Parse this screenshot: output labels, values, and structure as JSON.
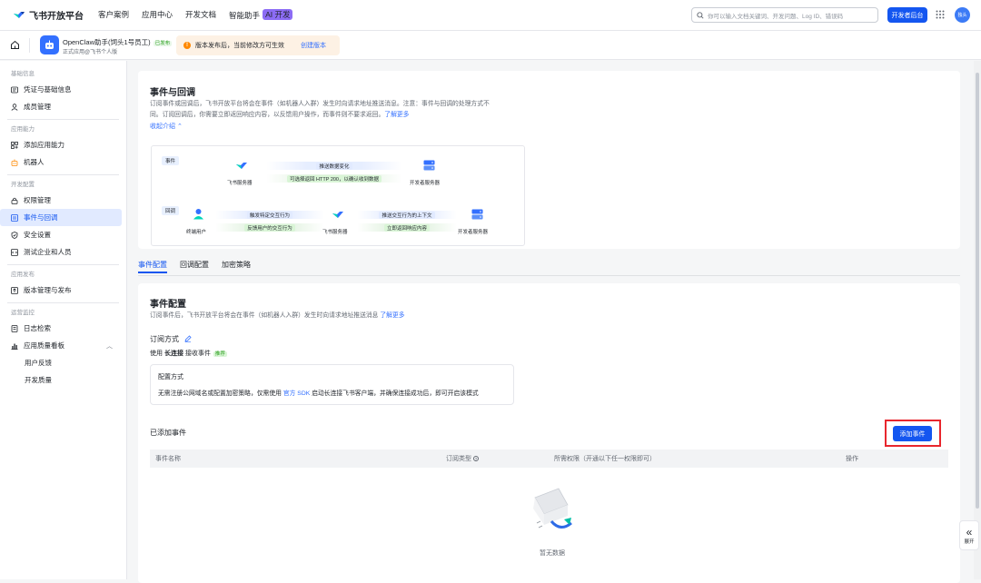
{
  "top": {
    "logo": "飞书开放平台",
    "nav": [
      "客户案例",
      "应用中心",
      "开发文档",
      "智能助手"
    ],
    "ai_badge": "AI 开发",
    "search_placeholder": "你可以输入文档关键词、开发问题、Log ID、错误码",
    "dev_console": "开发者后台",
    "avatar_text": "独头"
  },
  "app": {
    "name": "OpenClaw助手(饲头1号员工)",
    "status": "已发布",
    "subtitle": "正式应用@飞书个人版",
    "notice": "版本发布后，当前修改方可生效",
    "notice_link": "创建版本"
  },
  "sidebar": {
    "groups": [
      {
        "title": "基础信息",
        "items": [
          {
            "label": "凭证与基础信息",
            "icon": "id-card-icon"
          },
          {
            "label": "成员管理",
            "icon": "user-icon"
          }
        ]
      },
      {
        "title": "应用能力",
        "items": [
          {
            "label": "添加应用能力",
            "icon": "grid-plus-icon"
          },
          {
            "label": "机器人",
            "icon": "robot-icon"
          }
        ]
      },
      {
        "title": "开发配置",
        "items": [
          {
            "label": "权限管理",
            "icon": "lock-icon"
          },
          {
            "label": "事件与回调",
            "icon": "event-icon",
            "active": true
          },
          {
            "label": "安全设置",
            "icon": "shield-icon"
          },
          {
            "label": "测试企业和人员",
            "icon": "test-icon"
          }
        ]
      },
      {
        "title": "应用发布",
        "items": [
          {
            "label": "版本管理与发布",
            "icon": "version-icon"
          }
        ]
      },
      {
        "title": "运营监控",
        "items": [
          {
            "label": "日志检索",
            "icon": "log-icon"
          },
          {
            "label": "应用质量看板",
            "icon": "chart-icon",
            "expanded": true
          }
        ],
        "subitems": [
          "用户反馈",
          "开发质量"
        ]
      }
    ]
  },
  "intro": {
    "title": "事件与回调",
    "desc_line1": "订阅事件或回调后，飞书开放平台将会在事件（如机器人入群）发生时向请求地址推送消息。注意：事件与回调的处理方式不",
    "desc_line2": "同。订阅回调后，你需要立即返回响应内容，以反馈用户操作，而事件则不要求返回。",
    "learn_more": "了解更多",
    "collapse": "收起介绍",
    "diagram": {
      "event_tag": "事件",
      "callback_tag": "回调",
      "feishu_server": "飞书服务器",
      "dev_server": "开发者服务器",
      "end_user": "终端用户",
      "push_change": "推送数据变化",
      "ack_200": "可选择返回 HTTP 200，以确认收到数据",
      "trigger_action": "触发特定交互行为",
      "feedback_action": "反馈用户的交互行为",
      "push_context": "推送交互行为的上下文",
      "return_response": "立即返回响应内容"
    }
  },
  "tabs": [
    "事件配置",
    "回调配置",
    "加密策略"
  ],
  "event_config": {
    "title": "事件配置",
    "desc": "订阅事件后，飞书开放平台将会在事件（如机器人入群）发生时向请求地址推送消息",
    "learn_more": "了解更多",
    "sub_method": "订阅方式",
    "use": "使用",
    "long_conn": "长连接",
    "receive": "接收事件",
    "recommended": "推荐",
    "config_title": "配置方式",
    "config_desc_a": "无需注册公网域名或配置加密策略，仅需使用",
    "config_link": "官方 SDK",
    "config_desc_b": "启动长连接飞书客户端，并确保连接成功后，即可开启该模式",
    "added_events": "已添加事件",
    "add_button": "添加事件",
    "columns": [
      "事件名称",
      "订阅类型",
      "所需权限（开通以下任一权限即可）",
      "操作"
    ],
    "empty": "暂无数据"
  },
  "expand_label": "展开"
}
